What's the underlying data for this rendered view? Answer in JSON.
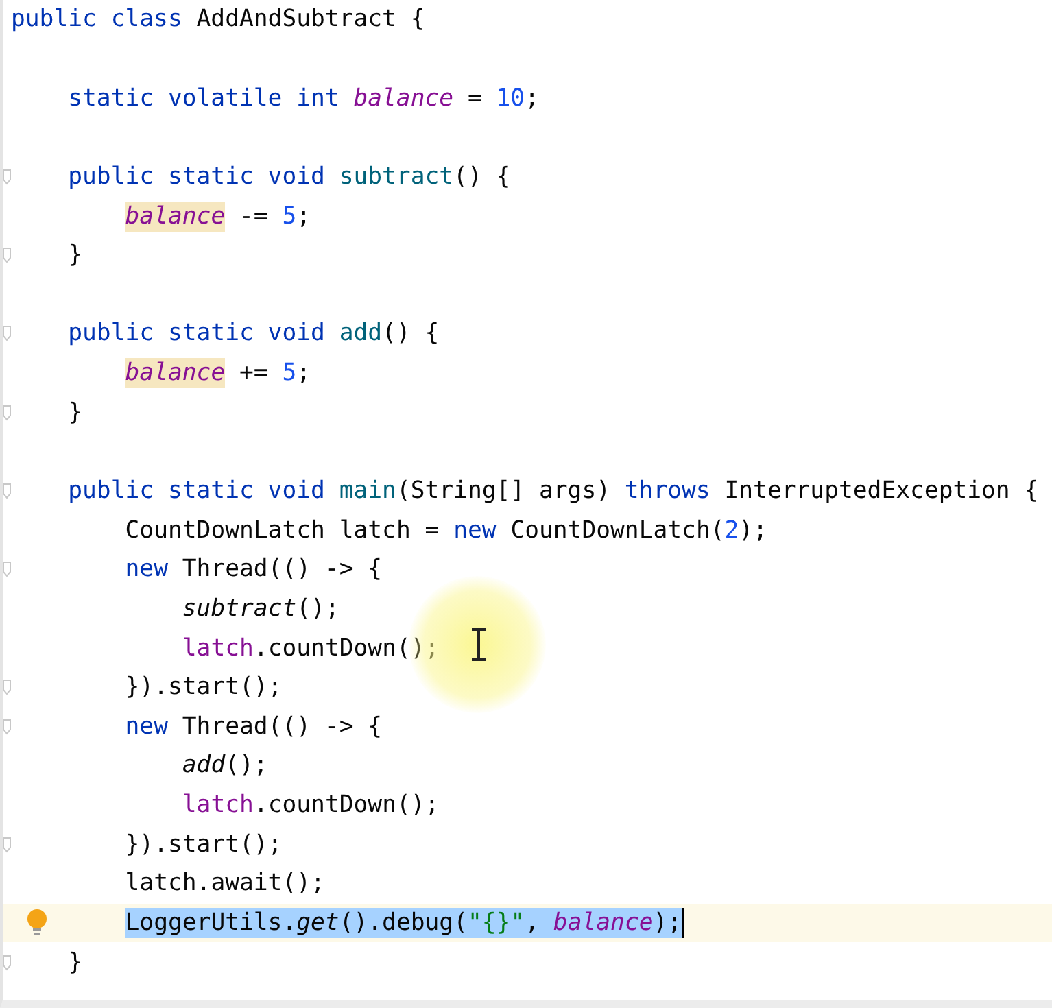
{
  "editor": {
    "lines": [
      {
        "kind": "code",
        "tokens": [
          {
            "t": "public class ",
            "kind": "keyword"
          },
          {
            "t": "AddAndSubtract {",
            "kind": "plain"
          }
        ],
        "children": [
          {
            "kind": "blank"
          },
          {
            "kind": "code",
            "tokens": [
              {
                "t": "static volatile int ",
                "kind": "keyword"
              },
              {
                "t": "balance",
                "kind": "field",
                "highlight": false
              },
              {
                "t": " = ",
                "kind": "plain"
              },
              {
                "t": "10",
                "kind": "number"
              },
              {
                "t": ";",
                "kind": "plain"
              }
            ]
          },
          {
            "kind": "blank"
          },
          {
            "kind": "code",
            "fold": true,
            "tokens": [
              {
                "t": "public static void ",
                "kind": "keyword"
              },
              {
                "t": "subtract",
                "kind": "method"
              },
              {
                "t": "() {",
                "kind": "plain"
              }
            ],
            "children": [
              {
                "kind": "code",
                "tokens": [
                  {
                    "t": "balance",
                    "kind": "field",
                    "highlight": true
                  },
                  {
                    "t": " -= ",
                    "kind": "plain"
                  },
                  {
                    "t": "5",
                    "kind": "number"
                  },
                  {
                    "t": ";",
                    "kind": "plain"
                  }
                ]
              }
            ]
          },
          {
            "kind": "code",
            "fold": true,
            "tokens": [
              {
                "t": "}",
                "kind": "plain"
              }
            ]
          },
          {
            "kind": "blank"
          },
          {
            "kind": "code",
            "fold": true,
            "tokens": [
              {
                "t": "public static void ",
                "kind": "keyword"
              },
              {
                "t": "add",
                "kind": "method"
              },
              {
                "t": "() {",
                "kind": "plain"
              }
            ],
            "children": [
              {
                "kind": "code",
                "tokens": [
                  {
                    "t": "balance",
                    "kind": "field",
                    "highlight": true
                  },
                  {
                    "t": " += ",
                    "kind": "plain"
                  },
                  {
                    "t": "5",
                    "kind": "number"
                  },
                  {
                    "t": ";",
                    "kind": "plain"
                  }
                ]
              }
            ]
          },
          {
            "kind": "code",
            "fold": true,
            "tokens": [
              {
                "t": "}",
                "kind": "plain"
              }
            ]
          },
          {
            "kind": "blank"
          },
          {
            "kind": "code",
            "fold": true,
            "tokens": [
              {
                "t": "public static void ",
                "kind": "keyword"
              },
              {
                "t": "main",
                "kind": "method"
              },
              {
                "t": "(String[] args) ",
                "kind": "plain"
              },
              {
                "t": "throws ",
                "kind": "keyword"
              },
              {
                "t": "InterruptedException {",
                "kind": "plain"
              }
            ],
            "children": [
              {
                "kind": "code",
                "tokens": [
                  {
                    "t": "CountDownLatch latch = ",
                    "kind": "plain"
                  },
                  {
                    "t": "new ",
                    "kind": "keyword"
                  },
                  {
                    "t": "CountDownLatch(",
                    "kind": "plain"
                  },
                  {
                    "t": "2",
                    "kind": "number"
                  },
                  {
                    "t": ");",
                    "kind": "plain"
                  }
                ]
              },
              {
                "kind": "code",
                "fold": true,
                "tokens": [
                  {
                    "t": "new ",
                    "kind": "keyword"
                  },
                  {
                    "t": "Thread(() -> {",
                    "kind": "plain"
                  }
                ],
                "children": [
                  {
                    "kind": "code",
                    "tokens": [
                      {
                        "t": "subtract",
                        "kind": "static-call"
                      },
                      {
                        "t": "();",
                        "kind": "plain"
                      }
                    ]
                  },
                  {
                    "kind": "code",
                    "tokens": [
                      {
                        "t": "latch",
                        "kind": "local"
                      },
                      {
                        "t": ".countDown();",
                        "kind": "plain"
                      }
                    ]
                  }
                ]
              },
              {
                "kind": "code",
                "fold": true,
                "tokens": [
                  {
                    "t": "}).start();",
                    "kind": "plain"
                  }
                ]
              },
              {
                "kind": "code",
                "fold": true,
                "tokens": [
                  {
                    "t": "new ",
                    "kind": "keyword"
                  },
                  {
                    "t": "Thread(() -> {",
                    "kind": "plain"
                  }
                ],
                "children": [
                  {
                    "kind": "code",
                    "tokens": [
                      {
                        "t": "add",
                        "kind": "static-call"
                      },
                      {
                        "t": "();",
                        "kind": "plain"
                      }
                    ]
                  },
                  {
                    "kind": "code",
                    "tokens": [
                      {
                        "t": "latch",
                        "kind": "local"
                      },
                      {
                        "t": ".countDown();",
                        "kind": "plain"
                      }
                    ]
                  }
                ]
              },
              {
                "kind": "code",
                "fold": true,
                "tokens": [
                  {
                    "t": "}).start();",
                    "kind": "plain"
                  }
                ]
              },
              {
                "kind": "code",
                "tokens": [
                  {
                    "t": "latch.await();",
                    "kind": "plain"
                  }
                ]
              },
              {
                "kind": "code",
                "current": true,
                "selected": true,
                "caret": true,
                "bulb": true,
                "tokens": [
                  {
                    "t": "LoggerUtils.",
                    "kind": "plain"
                  },
                  {
                    "t": "get",
                    "kind": "static-call"
                  },
                  {
                    "t": "().debug(",
                    "kind": "plain"
                  },
                  {
                    "t": "\"{}\"",
                    "kind": "string"
                  },
                  {
                    "t": ", ",
                    "kind": "plain"
                  },
                  {
                    "t": "balance",
                    "kind": "field",
                    "highlight": false
                  },
                  {
                    "t": ");",
                    "kind": "plain"
                  }
                ]
              }
            ]
          },
          {
            "kind": "code",
            "fold": true,
            "tokens": [
              {
                "t": "}",
                "kind": "plain"
              }
            ]
          }
        ]
      }
    ]
  }
}
